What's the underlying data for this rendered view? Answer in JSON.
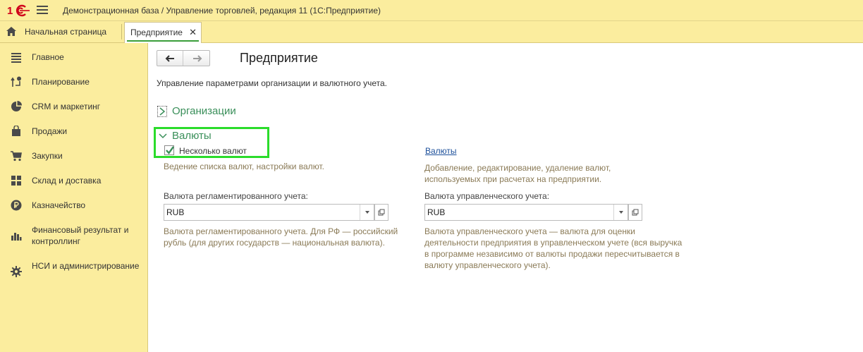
{
  "titlebar": {
    "logo": "1С",
    "menu_icon": "burger-menu-icon",
    "title": "Демонстрационная база / Управление торговлей, редакция 11  (1С:Предприятие)"
  },
  "tabs": {
    "home_label": "Начальная страница",
    "active_label": "Предприятие",
    "close_glyph": "✕"
  },
  "sidebar": {
    "items": [
      {
        "label": "Главное",
        "icon": "list-icon"
      },
      {
        "label": "Планирование",
        "icon": "planning-icon"
      },
      {
        "label": "CRM и маркетинг",
        "icon": "pie-chart-icon"
      },
      {
        "label": "Продажи",
        "icon": "bag-icon"
      },
      {
        "label": "Закупки",
        "icon": "cart-icon"
      },
      {
        "label": "Склад и доставка",
        "icon": "warehouse-grid-icon"
      },
      {
        "label": "Казначейство",
        "icon": "ruble-coin-icon"
      },
      {
        "label": "Финансовый результат и контроллинг",
        "icon": "bar-chart-icon"
      },
      {
        "label": "НСИ и администрирование",
        "icon": "gear-icon"
      }
    ]
  },
  "main": {
    "title": "Предприятие",
    "description": "Управление параметрами организации и валютного учета.",
    "group_organizations": "Организации",
    "group_currencies": "Валюты",
    "checkbox_label": "Несколько валют",
    "checkbox_checked": true,
    "checkbox_hint": "Ведение списка валют, настройки валют.",
    "link_currencies": "Валюты",
    "link_hint_1": "Добавление, редактирование, удаление валют,",
    "link_hint_2": "используемых при расчетах на предприятии.",
    "reg_currency_label": "Валюта регламентированного учета:",
    "reg_currency_value": "RUB",
    "reg_hint_1": "Валюта регламентированного учета. Для РФ — российский",
    "reg_hint_2": "рубль (для других государств — национальная валюта).",
    "mgmt_currency_label": "Валюта управленческого учета:",
    "mgmt_currency_value": "RUB",
    "mgmt_hint_1": "Валюта управленческого учета — валюта для оценки",
    "mgmt_hint_2": "деятельности предприятия в управленческом учете (вся выручка",
    "mgmt_hint_3": "в программе независимо от валюты продажи пересчитывается в",
    "mgmt_hint_4": "валюту управленческого учета)."
  },
  "colors": {
    "panel_bg": "#fbed9e",
    "group_green": "#3a8f5a",
    "highlight": "#2bdc2b",
    "link": "#1c4f9a",
    "hint": "#8a7a56"
  }
}
